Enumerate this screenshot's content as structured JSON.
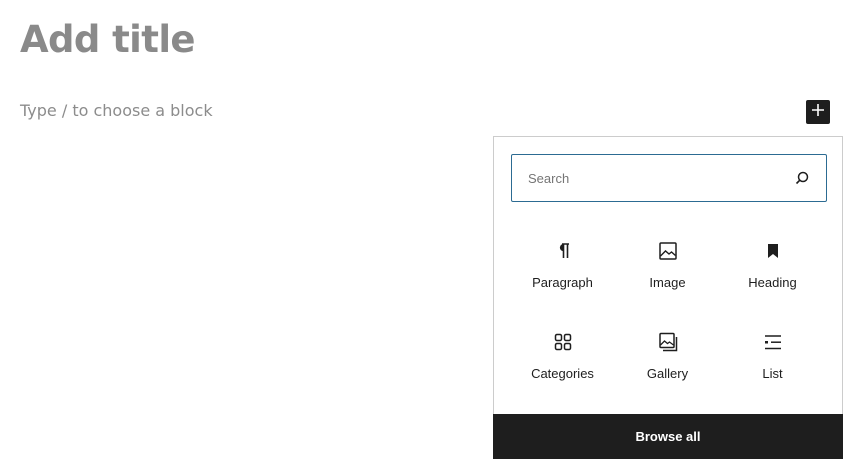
{
  "editor": {
    "title_placeholder": "Add title",
    "block_placeholder": "Type / to choose a block",
    "inserter_toggle_icon": "plus-icon"
  },
  "inserter": {
    "search_placeholder": "Search",
    "search_value": "",
    "search_icon": "search-icon",
    "blocks": [
      {
        "label": "Paragraph",
        "icon": "paragraph-icon"
      },
      {
        "label": "Image",
        "icon": "image-icon"
      },
      {
        "label": "Heading",
        "icon": "bookmark-icon"
      },
      {
        "label": "Categories",
        "icon": "categories-icon"
      },
      {
        "label": "Gallery",
        "icon": "gallery-icon"
      },
      {
        "label": "List",
        "icon": "list-icon"
      }
    ],
    "browse_all_label": "Browse all"
  },
  "colors": {
    "search_border": "#2c6b92",
    "dark": "#1e1e1e",
    "placeholder_text": "#8a8a8a"
  }
}
